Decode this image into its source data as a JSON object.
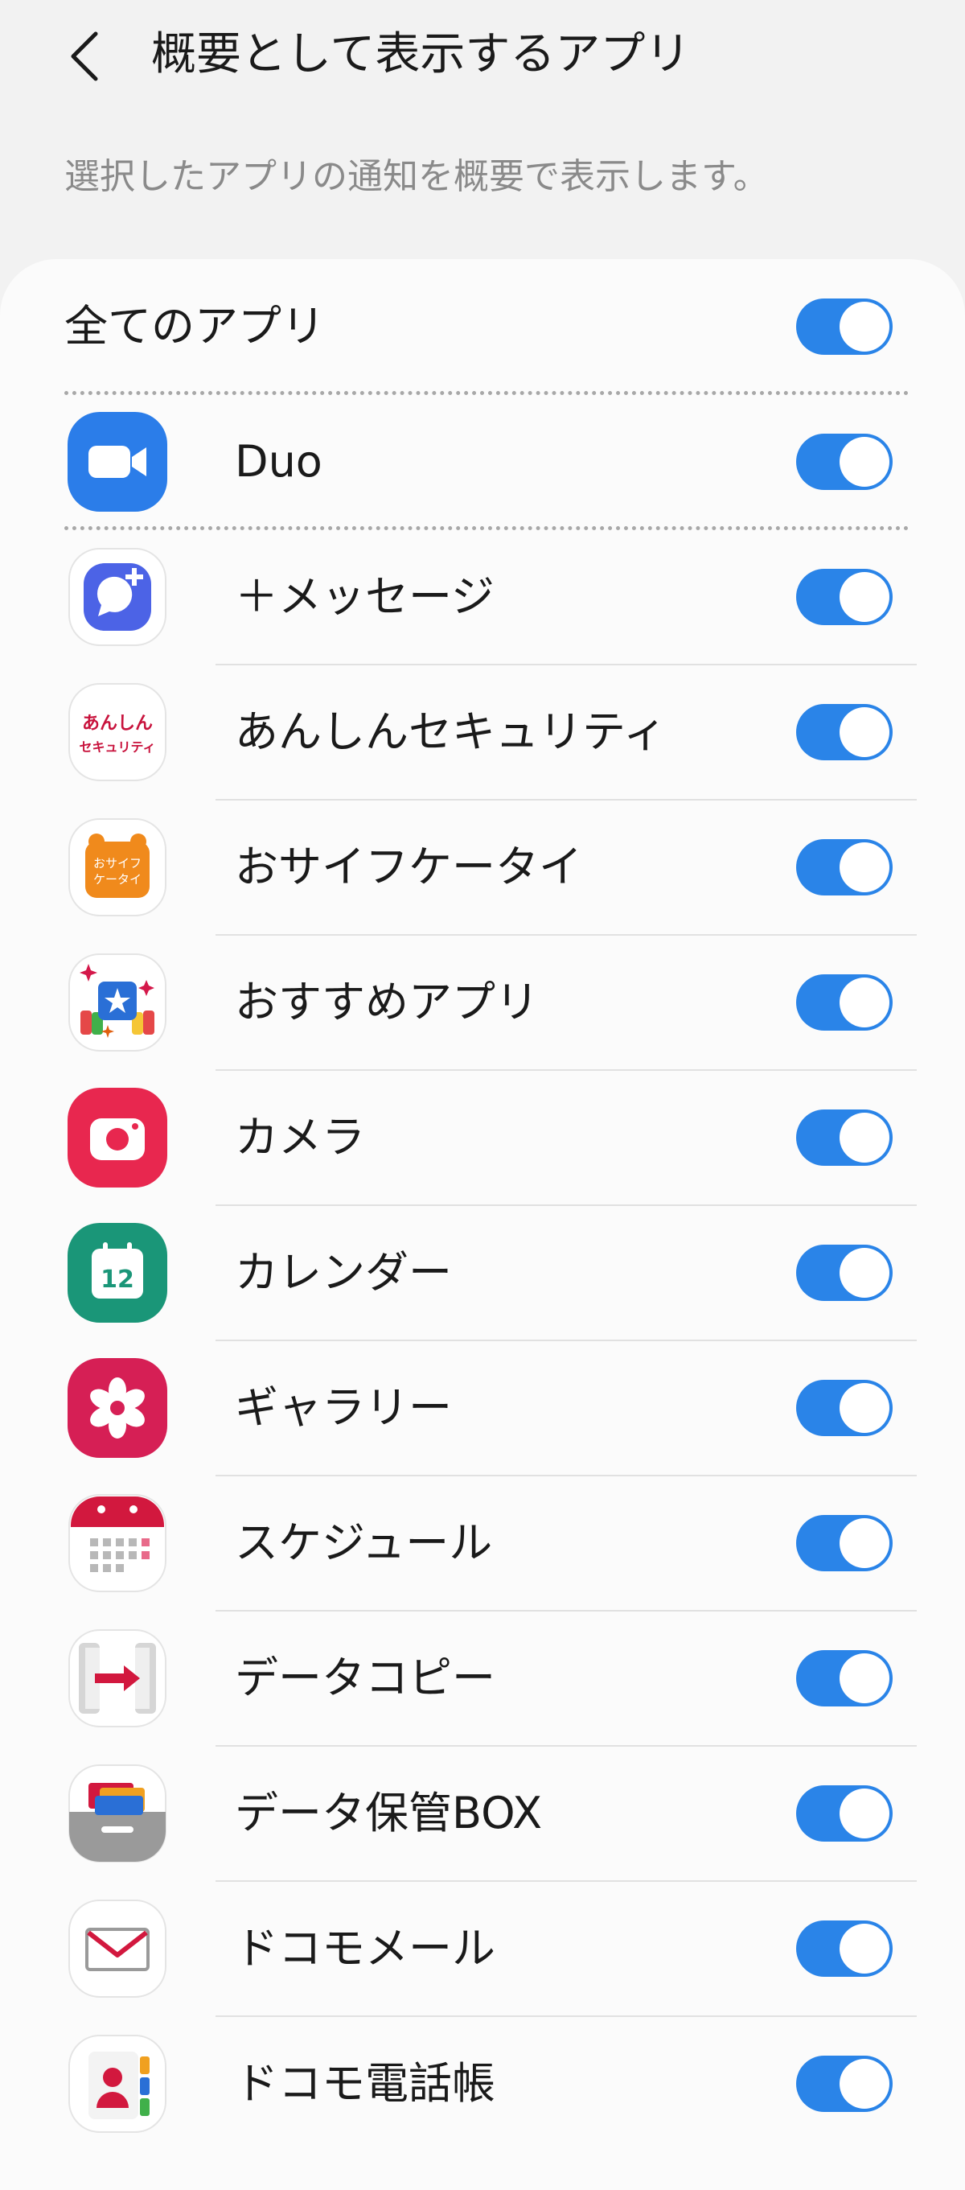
{
  "header": {
    "back_icon": "chevron-left-icon",
    "title": "概要として表示するアプリ"
  },
  "description": "選択したアプリの通知を概要で表示します。",
  "all_apps": {
    "label": "全てのアプリ",
    "enabled": true
  },
  "apps": [
    {
      "label": "Duo",
      "icon": "duo-icon",
      "enabled": true
    },
    {
      "label": "＋メッセージ",
      "icon": "plus-message-icon",
      "enabled": true
    },
    {
      "label": "あんしんセキュリティ",
      "icon": "anshin-security-icon",
      "icon_text_1": "あんしん",
      "icon_text_2": "セキュリティ",
      "enabled": true
    },
    {
      "label": "おサイフケータイ",
      "icon": "osaifu-keitai-icon",
      "icon_text_1": "おサイフ",
      "icon_text_2": "ケータイ",
      "enabled": true
    },
    {
      "label": "おすすめアプリ",
      "icon": "recommended-apps-icon",
      "enabled": true
    },
    {
      "label": "カメラ",
      "icon": "camera-icon",
      "enabled": true
    },
    {
      "label": "カレンダー",
      "icon": "calendar-icon",
      "icon_text_1": "12",
      "enabled": true
    },
    {
      "label": "ギャラリー",
      "icon": "gallery-icon",
      "enabled": true
    },
    {
      "label": "スケジュール",
      "icon": "schedule-icon",
      "enabled": true
    },
    {
      "label": "データコピー",
      "icon": "data-copy-icon",
      "enabled": true
    },
    {
      "label": "データ保管BOX",
      "icon": "data-storage-box-icon",
      "enabled": true
    },
    {
      "label": "ドコモメール",
      "icon": "docomo-mail-icon",
      "enabled": true
    },
    {
      "label": "ドコモ電話帳",
      "icon": "docomo-phonebook-icon",
      "enabled": true
    }
  ],
  "colors": {
    "toggle_on": "#2a84e8",
    "background": "#f2f2f2",
    "card": "#fbfbfb"
  }
}
